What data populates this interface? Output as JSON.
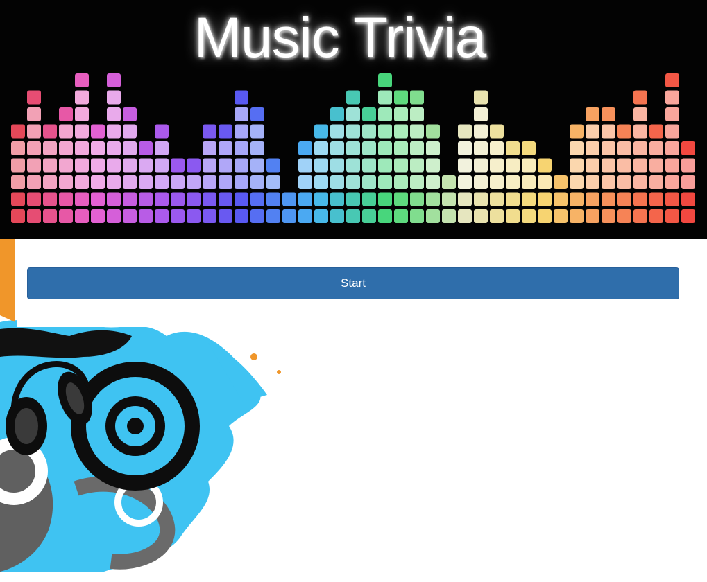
{
  "header": {
    "title": "Music Trivia",
    "image": "equalizer-banner"
  },
  "main": {
    "start_label": "Start"
  },
  "background": {
    "image": "headphones-splash-art"
  },
  "colors": {
    "button": "#2f6eab",
    "splash_blue": "#3fc3f2",
    "splash_orange": "#f0962a",
    "banner_bg": "#030303"
  }
}
